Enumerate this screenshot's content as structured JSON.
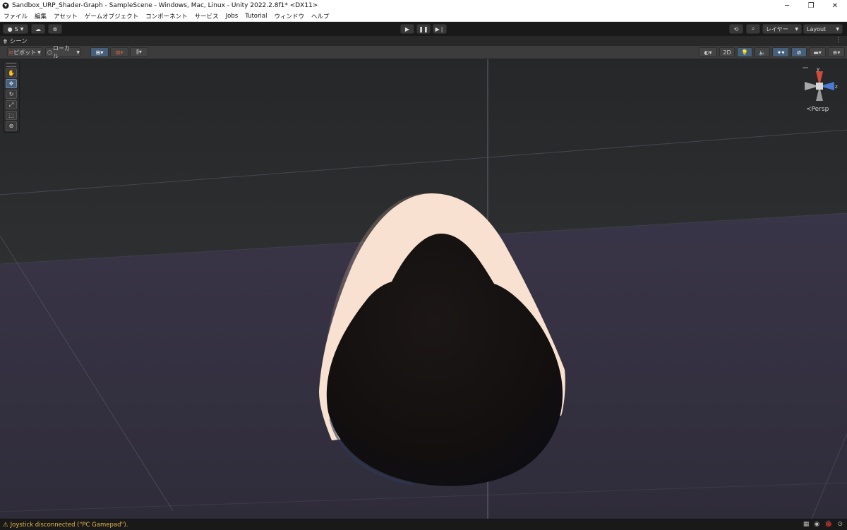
{
  "window": {
    "title": "Sandbox_URP_Shader-Graph - SampleScene - Windows, Mac, Linux - Unity 2022.2.8f1* <DX11>",
    "minimize": "─",
    "maximize": "❐",
    "close": "✕"
  },
  "menu": [
    "ファイル",
    "編集",
    "アセット",
    "ゲームオブジェクト",
    "コンポーネント",
    "サービス",
    "Jobs",
    "Tutorial",
    "ウィンドウ",
    "ヘルプ"
  ],
  "toolbar": {
    "account_label": "S",
    "layers_label": "レイヤー",
    "layout_label": "Layout"
  },
  "scene_tab": {
    "label": "シーン",
    "menu_glyph": "⋮"
  },
  "scene_toolbar": {
    "pivot_label": "ピボット",
    "local_label": "ローカル",
    "mode_2d_label": "2D"
  },
  "gizmo": {
    "projection_label": "≺Persp",
    "y_axis": "y",
    "z_axis": "z"
  },
  "status": {
    "message": "Joystick disconnected (\"PC Gamepad\")."
  },
  "colors": {
    "titlebar_bg": "#ffffff",
    "editor_bg": "#282828",
    "accent_blue": "#46607c",
    "glow_color": "#f7e0cf",
    "warning_text": "#e6b64a"
  }
}
